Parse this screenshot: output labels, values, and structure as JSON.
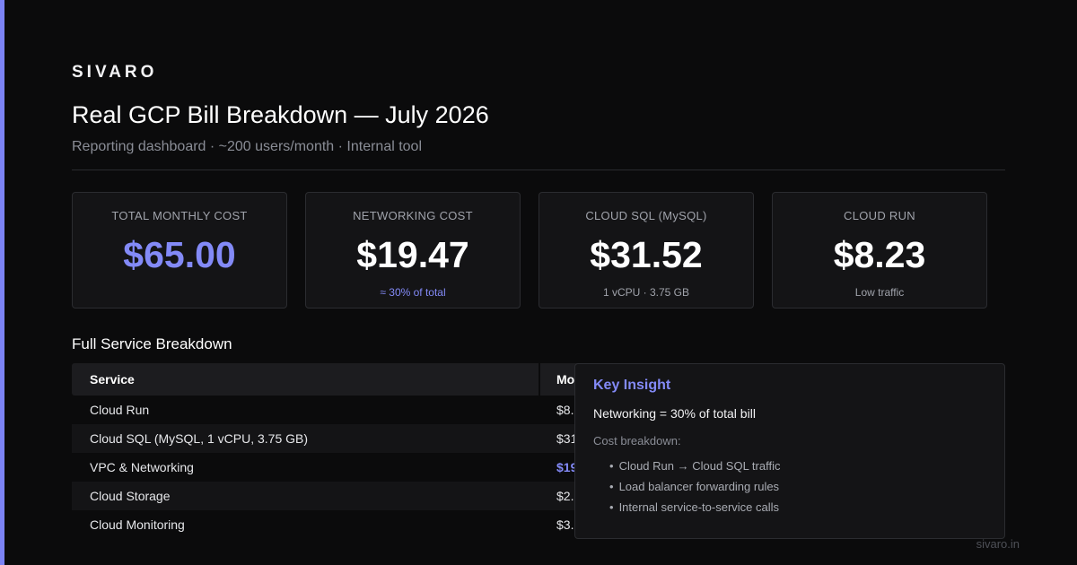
{
  "brand": "SIVARO",
  "title": "Real GCP Bill Breakdown — July 2026",
  "subtitle": "Reporting dashboard · ~200 users/month · Internal tool",
  "colors": {
    "accent": "#838af7",
    "background": "#0b0b0c",
    "card": "#141416"
  },
  "cards": [
    {
      "label": "TOTAL MONTHLY COST",
      "value": "$65.00",
      "note": ""
    },
    {
      "label": "NETWORKING COST",
      "value": "$19.47",
      "note": "≈ 30% of total"
    },
    {
      "label": "CLOUD SQL (MySQL)",
      "value": "$31.52",
      "note": "1 vCPU · 3.75 GB"
    },
    {
      "label": "CLOUD RUN",
      "value": "$8.23",
      "note": "Low traffic"
    }
  ],
  "breakdown": {
    "title": "Full Service Breakdown",
    "columns": [
      "Service",
      "Mo"
    ],
    "rows": [
      {
        "service": "Cloud Run",
        "cost": "$8."
      },
      {
        "service": "Cloud SQL (MySQL, 1 vCPU, 3.75 GB)",
        "cost": "$31"
      },
      {
        "service": "VPC & Networking",
        "cost": "$19"
      },
      {
        "service": "Cloud Storage",
        "cost": "$2."
      },
      {
        "service": "Cloud Monitoring",
        "cost": "$3."
      }
    ]
  },
  "insight": {
    "title": "Key Insight",
    "headline": "Networking = 30% of total bill",
    "subheading": "Cost breakdown:",
    "items": [
      "Cloud Run → Cloud SQL traffic",
      "Load balancer forwarding rules",
      "Internal service-to-service calls"
    ]
  },
  "footer": "sivaro.in"
}
